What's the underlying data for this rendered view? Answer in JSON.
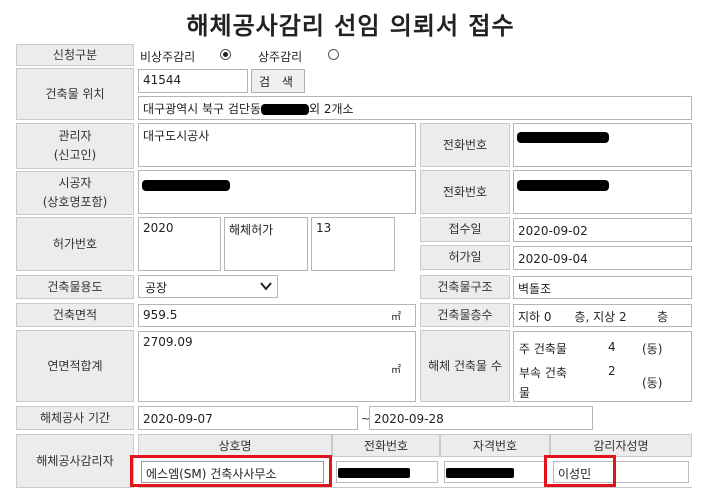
{
  "page_title": "해체공사감리 선임 의뢰서 접수",
  "request_type": {
    "label": "신청구분",
    "option1": "비상주감리",
    "option2": "상주감리",
    "selected": "비상주감리"
  },
  "location": {
    "label": "건축물 위치",
    "zipcode": "41544",
    "search_button": "검 색",
    "address_prefix": "대구광역시 북구 검단동",
    "address_suffix": "외 2개소"
  },
  "manager": {
    "label_line1": "관리자",
    "label_line2": "(신고인)",
    "value": "대구도시공사",
    "phone_label": "전화번호"
  },
  "contractor": {
    "label_line1": "시공자",
    "label_line2": "(상호명포함)",
    "phone_label": "전화번호"
  },
  "permit": {
    "label": "허가번호",
    "year": "2020",
    "type": "해체허가",
    "number": "13",
    "received_label": "접수일",
    "received_date": "2020-09-02",
    "permit_date_label": "허가일",
    "permit_date": "2020-09-04"
  },
  "usage": {
    "label": "건축물용도",
    "selected": "공장",
    "structure_label": "건축물구조",
    "structure": "벽돌조"
  },
  "area": {
    "label": "건축면적",
    "value": "959.5",
    "unit": "㎡",
    "floors_label": "건축물층수",
    "floors_text": "지하 0      층, 지상 2        층"
  },
  "total_area": {
    "label": "연면적합계",
    "value": "2709.09",
    "unit": "㎡",
    "demolish_label": "해체 건축물 수",
    "main_label": "주 건축물",
    "main_count": "4",
    "main_unit": "(동)",
    "sub_label_line1": "부속 건축",
    "sub_label_line2": "물",
    "sub_count": "2",
    "sub_unit": "(동)"
  },
  "period": {
    "label": "해체공사 기간",
    "start": "2020-09-07",
    "separator": "~",
    "end": "2020-09-28"
  },
  "supervisor": {
    "label": "해체공사감리자",
    "headers": [
      "상호명",
      "전화번호",
      "자격번호",
      "감리자성명"
    ],
    "company": "에스엠(SM) 건축사사무소",
    "name": "이성민"
  },
  "colors": {
    "highlight_border": "#e3131b",
    "label_bg": "#ececec"
  }
}
